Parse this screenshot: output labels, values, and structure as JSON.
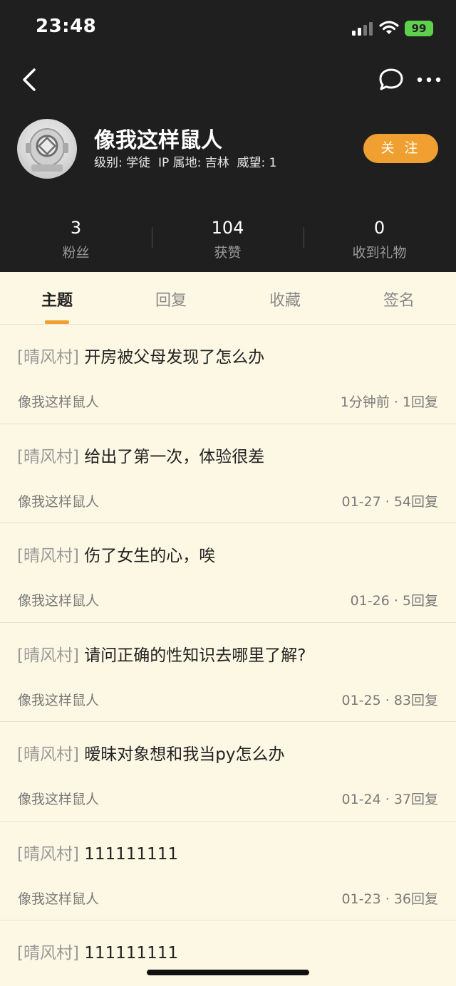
{
  "status_bar": {
    "time": "23:48",
    "battery": "99"
  },
  "profile": {
    "username": "像我这样鼠人",
    "meta": "级别: 学徒  IP 属地: 吉林  威望: 1",
    "follow_label": "关 注"
  },
  "stats": [
    {
      "value": "3",
      "label": "粉丝"
    },
    {
      "value": "104",
      "label": "获赞"
    },
    {
      "value": "0",
      "label": "收到礼物"
    }
  ],
  "tabs": [
    "主题",
    "回复",
    "收藏",
    "签名"
  ],
  "active_tab": "主题",
  "posts": [
    {
      "tag": "[晴风村]",
      "title": "开房被父母发现了怎么办",
      "author": "像我这样鼠人",
      "info": "1分钟前 · 1回复"
    },
    {
      "tag": "[晴风村]",
      "title": "给出了第一次，体验很差",
      "author": "像我这样鼠人",
      "info": "01-27 · 54回复"
    },
    {
      "tag": "[晴风村]",
      "title": "伤了女生的心，唉",
      "author": "像我这样鼠人",
      "info": "01-26 · 5回复"
    },
    {
      "tag": "[晴风村]",
      "title": "请问正确的性知识去哪里了解?",
      "author": "像我这样鼠人",
      "info": "01-25 · 83回复"
    },
    {
      "tag": "[晴风村]",
      "title": "暧昧对象想和我当py怎么办",
      "author": "像我这样鼠人",
      "info": "01-24 · 37回复"
    },
    {
      "tag": "[晴风村]",
      "title": "111111111",
      "author": "像我这样鼠人",
      "info": "01-23 · 36回复"
    },
    {
      "tag": "[晴风村]",
      "title": "111111111",
      "author": "",
      "info": ""
    }
  ],
  "colors": {
    "header_bg": "#1f1f1f",
    "accent": "#f0a030",
    "page_bg": "#fdf8e4",
    "battery": "#5fcf4e"
  },
  "icons": {
    "back": "chevron-left-icon",
    "chat": "chat-bubble-icon",
    "more": "more-dots-icon"
  }
}
